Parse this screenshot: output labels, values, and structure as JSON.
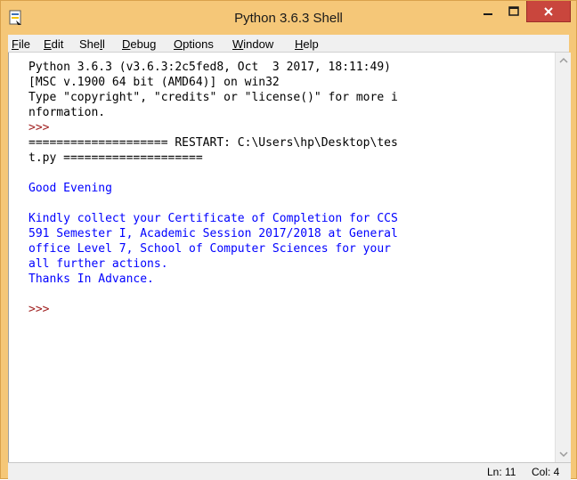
{
  "window": {
    "title": "Python 3.6.3 Shell",
    "icon": "idle-shell-icon",
    "accent_color": "#f5c778",
    "close_color": "#c9463d"
  },
  "menu": {
    "items": [
      {
        "label": "File"
      },
      {
        "label": "Edit"
      },
      {
        "label": "Shell"
      },
      {
        "label": "Debug"
      },
      {
        "label": "Options"
      },
      {
        "label": "Window"
      },
      {
        "label": "Help"
      }
    ]
  },
  "shell": {
    "lines": [
      "Python 3.6.3 (v3.6.3:2c5fed8, Oct  3 2017, 18:11:49)",
      "[MSC v.1900 64 bit (AMD64)] on win32",
      "Type \"copyright\", \"credits\" or \"license()\" for more i",
      "nformation.",
      ">>>",
      "==================== RESTART: C:\\Users\\hp\\Desktop\\tes",
      "t.py ====================",
      "",
      "Good Evening",
      "",
      "Kindly collect your Certificate of Completion for CCS",
      "591 Semester I, Academic Session 2017/2018 at General",
      "office Level 7, School of Computer Sciences for your",
      "all further actions.",
      "Thanks In Advance.",
      "",
      ">>>"
    ],
    "output_color": "#0000ff",
    "prompt_color": "#a01f1f"
  },
  "status": {
    "line": "Ln: 11",
    "col": "Col: 4"
  }
}
